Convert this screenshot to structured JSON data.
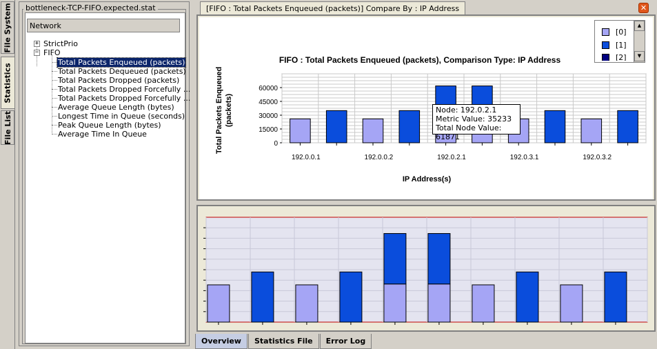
{
  "vertical_tabs": [
    {
      "label": "File System",
      "active": false
    },
    {
      "label": "Statistics",
      "active": true
    },
    {
      "label": "File List",
      "active": false
    }
  ],
  "left_panel": {
    "title": "bottleneck-TCP-FIFO.expected.stat",
    "network_label": "Network",
    "tree": {
      "strictprio": {
        "label": "StrictPrio",
        "expander": "+"
      },
      "fifo": {
        "label": "FIFO",
        "expander": "−",
        "items": [
          {
            "label": "Total Packets Enqueued (packets)",
            "selected": true
          },
          {
            "label": "Total Packets Dequeued (packets)",
            "selected": false
          },
          {
            "label": "Total Packets Dropped (packets)",
            "selected": false
          },
          {
            "label": "Total Packets Dropped Forcefully ...",
            "selected": false
          },
          {
            "label": "Total Packets Dropped Forcefully ...",
            "selected": false
          },
          {
            "label": "Average Queue Length (bytes)",
            "selected": false
          },
          {
            "label": "Longest Time in Queue (seconds)",
            "selected": false
          },
          {
            "label": "Peak Queue Length (bytes)",
            "selected": false
          },
          {
            "label": "Average Time In Queue",
            "selected": false
          }
        ]
      }
    }
  },
  "chart_tab": {
    "label": "[FIFO :  Total Packets Enqueued (packets)] Compare By : IP Address",
    "close_icon": "close-icon"
  },
  "colors": {
    "series0": "#a5a5f5",
    "series1": "#0a4ddc",
    "series2": "#000080",
    "plot_border_overview": "#c00000",
    "selection": "#0a246a"
  },
  "legend": {
    "items": [
      {
        "label": "[0]",
        "color": "#a5a5f5"
      },
      {
        "label": "[1]",
        "color": "#0a4ddc"
      },
      {
        "label": "[2]",
        "color": "#000080"
      }
    ]
  },
  "tooltip": {
    "line1": "Node: 192.0.2.1",
    "line2": "Metric Value: 35233",
    "line3": "Total Node Value: 61871"
  },
  "chart_data": {
    "type": "bar",
    "stacked": true,
    "title": "FIFO :  Total Packets Enqueued (packets), Comparison Type: IP Address",
    "xlabel": "IP Address(s)",
    "ylabel": "Total Packets Enqueued\n(packets)",
    "ylim": [
      0,
      75000
    ],
    "yticks": [
      0,
      15000,
      30000,
      45000,
      60000
    ],
    "ytick_labels": [
      "0",
      "15000",
      "30000",
      "45000",
      "60000"
    ],
    "grid": true,
    "x_tick_labels": [
      "192.0.0.1",
      "192.0.0.2",
      "192.0.2.1",
      "192.0.3.1",
      "192.0.3.2"
    ],
    "categories": [
      "192.0.0.1",
      "192.0.0.1",
      "192.0.0.2",
      "192.0.0.2",
      "192.0.2.1",
      "192.0.2.1",
      "192.0.3.1",
      "192.0.3.1",
      "192.0.3.2",
      "192.0.3.2"
    ],
    "series": [
      {
        "name": "[0]",
        "values": [
          26000,
          0,
          26000,
          0,
          26600,
          26600,
          26000,
          0,
          26000,
          0
        ]
      },
      {
        "name": "[1]",
        "values": [
          0,
          35000,
          0,
          35000,
          35233,
          35233,
          0,
          35000,
          0,
          35000
        ]
      }
    ]
  },
  "bottom_tabs": [
    {
      "label": "Overview",
      "active": true
    },
    {
      "label": "Statistics File",
      "active": false
    },
    {
      "label": "Error Log",
      "active": false
    }
  ]
}
